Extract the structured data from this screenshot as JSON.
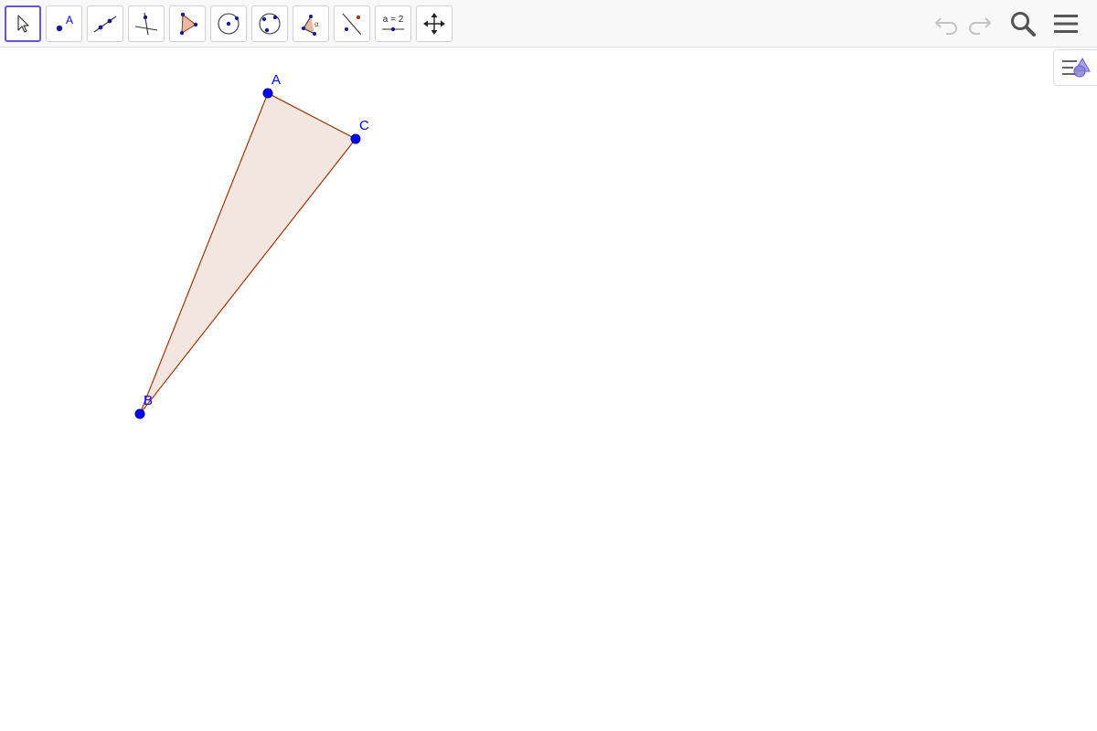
{
  "toolbar": {
    "tools": [
      {
        "name": "move-tool",
        "icon": "cursor-arrow-icon",
        "selected": true
      },
      {
        "name": "point-tool",
        "icon": "point-icon",
        "label": "A"
      },
      {
        "name": "line-tool",
        "icon": "line-through-two-points-icon"
      },
      {
        "name": "perpendicular-line-tool",
        "icon": "perpendicular-line-icon"
      },
      {
        "name": "polygon-tool",
        "icon": "polygon-icon"
      },
      {
        "name": "circle-center-point-tool",
        "icon": "circle-center-point-icon"
      },
      {
        "name": "circle-three-points-tool",
        "icon": "circle-three-points-icon"
      },
      {
        "name": "angle-tool",
        "icon": "angle-icon",
        "label": "α"
      },
      {
        "name": "reflect-about-line-tool",
        "icon": "reflect-line-icon"
      },
      {
        "name": "slider-tool",
        "icon": "slider-icon",
        "label": "a = 2"
      },
      {
        "name": "move-graphics-view-tool",
        "icon": "move-arrows-icon"
      }
    ],
    "right": [
      {
        "name": "undo-button",
        "icon": "undo-icon",
        "enabled": false
      },
      {
        "name": "redo-button",
        "icon": "redo-icon",
        "enabled": false
      },
      {
        "name": "search-button",
        "icon": "search-icon"
      },
      {
        "name": "menu-button",
        "icon": "hamburger-menu-icon"
      }
    ]
  },
  "style_bar_toggle": {
    "icon": "style-bar-icon"
  },
  "construction": {
    "points": [
      {
        "label": "A",
        "color": "#0000ff"
      },
      {
        "label": "B",
        "color": "#0000ff"
      },
      {
        "label": "C",
        "color": "#0000ff"
      }
    ],
    "polygon": {
      "vertices": [
        "A",
        "B",
        "C"
      ],
      "fill_color": "#f3e6e1",
      "stroke_color": "#993300"
    }
  },
  "colors": {
    "accent": "#6557d2",
    "point": "#0000ff",
    "polygon_stroke": "#993300"
  }
}
